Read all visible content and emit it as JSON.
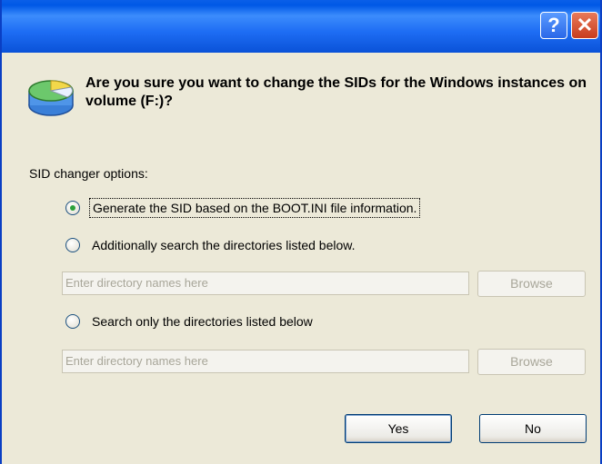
{
  "titlebar": {
    "help_label": "?",
    "close_label": "✕"
  },
  "dialog": {
    "question": "Are you sure you want to change the SIDs for the Windows instances on volume (F:)?",
    "options_label": "SID changer options:",
    "options": [
      {
        "label": "Generate the SID based on the BOOT.INI file information.",
        "selected": true
      },
      {
        "label": "Additionally search the directories listed below.",
        "selected": false
      },
      {
        "label": "Search only the directories listed below",
        "selected": false
      }
    ],
    "dir_field_1": {
      "placeholder": "Enter directory names here",
      "value": ""
    },
    "dir_field_2": {
      "placeholder": "Enter directory names here",
      "value": ""
    },
    "browse_1": "Browse",
    "browse_2": "Browse",
    "yes_label": "Yes",
    "no_label": "No"
  }
}
